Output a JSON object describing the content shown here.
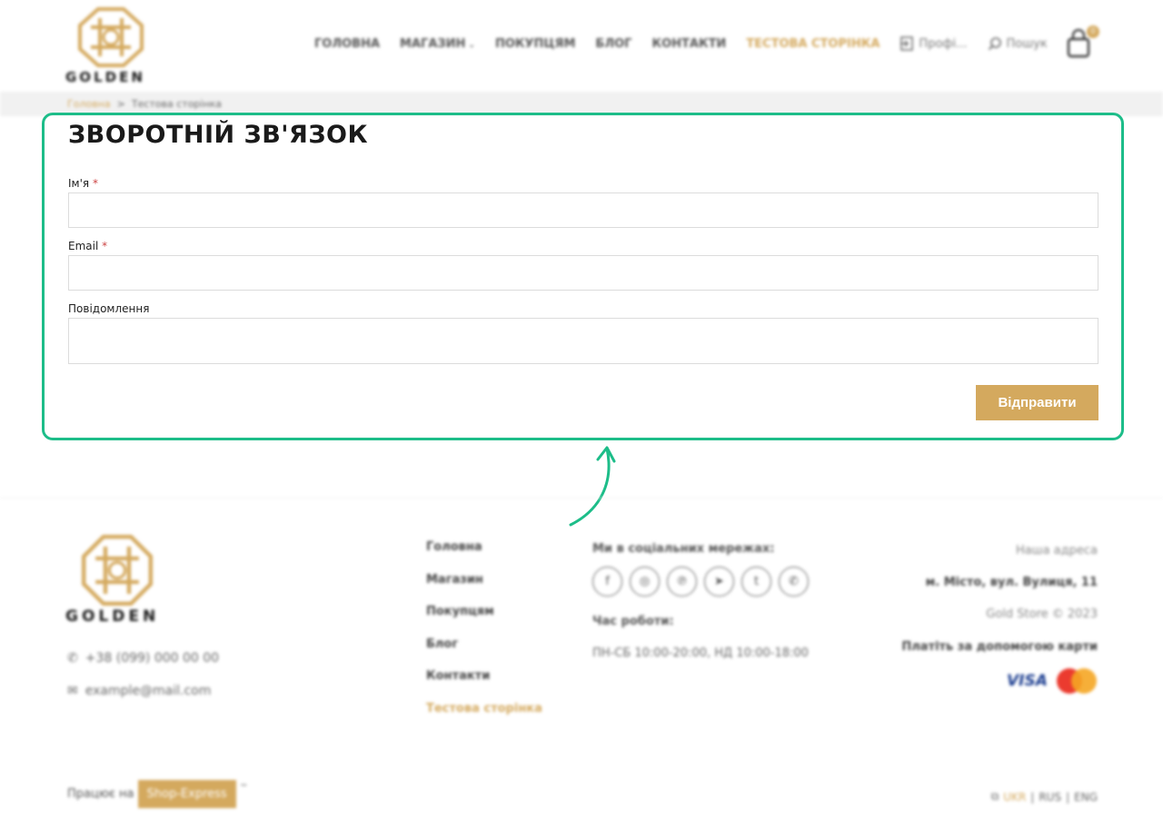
{
  "header": {
    "brand": "GOLDEN",
    "nav": [
      {
        "label": "ГОЛОВНА"
      },
      {
        "label": "МАГАЗИН"
      },
      {
        "label": "ПОКУПЦЯМ"
      },
      {
        "label": "БЛОГ"
      },
      {
        "label": "КОНТАКТИ"
      },
      {
        "label": "ТЕСТОВА СТОРІНКА"
      }
    ],
    "profile_label": "Профі...",
    "search_label": "Пошук",
    "cart_count": "0"
  },
  "breadcrumb": {
    "home": "Головна",
    "separator": ">",
    "current": "Тестова сторінка"
  },
  "form": {
    "title": "ЗВОРОТНІЙ ЗВ'ЯЗОК",
    "name_label": "Ім'я",
    "email_label": "Email",
    "message_label": "Повідомлення",
    "required_mark": "*",
    "name_value": "",
    "email_value": "",
    "message_value": "",
    "submit_label": "Відправити"
  },
  "footer": {
    "brand": "GOLDEN",
    "phone": "+38 (099) 000 00 00",
    "email": "example@mail.com",
    "menu": [
      {
        "label": "Головна"
      },
      {
        "label": "Магазин"
      },
      {
        "label": "Покупцям"
      },
      {
        "label": "Блог"
      },
      {
        "label": "Контакти"
      },
      {
        "label": "Тестова сторінка"
      }
    ],
    "social_title": "Ми в соціальних мережах:",
    "social_icons": [
      "facebook-icon",
      "instagram-icon",
      "pinterest-icon",
      "telegram-icon",
      "twitter-icon",
      "whatsapp-icon"
    ],
    "hours_title": "Час роботи:",
    "hours": "ПН-СБ 10:00-20:00, НД 10:00-18:00",
    "address_title": "Наша адреса",
    "address": "м. Місто, вул. Вулиця, 11",
    "copyright": "Gold Store © 2023",
    "pay_title": "Платіть за допомогою карти",
    "visa": "VISA",
    "powered_prefix": "Працює на",
    "powered_brand": "Shop-Express",
    "powered_suffix": "™",
    "languages": [
      {
        "label": "UKR"
      },
      {
        "label": "RUS"
      },
      {
        "label": "ENG"
      }
    ],
    "lang_separator": "|"
  },
  "colors": {
    "accent": "#d4a95e",
    "highlight": "#1dbd89"
  }
}
